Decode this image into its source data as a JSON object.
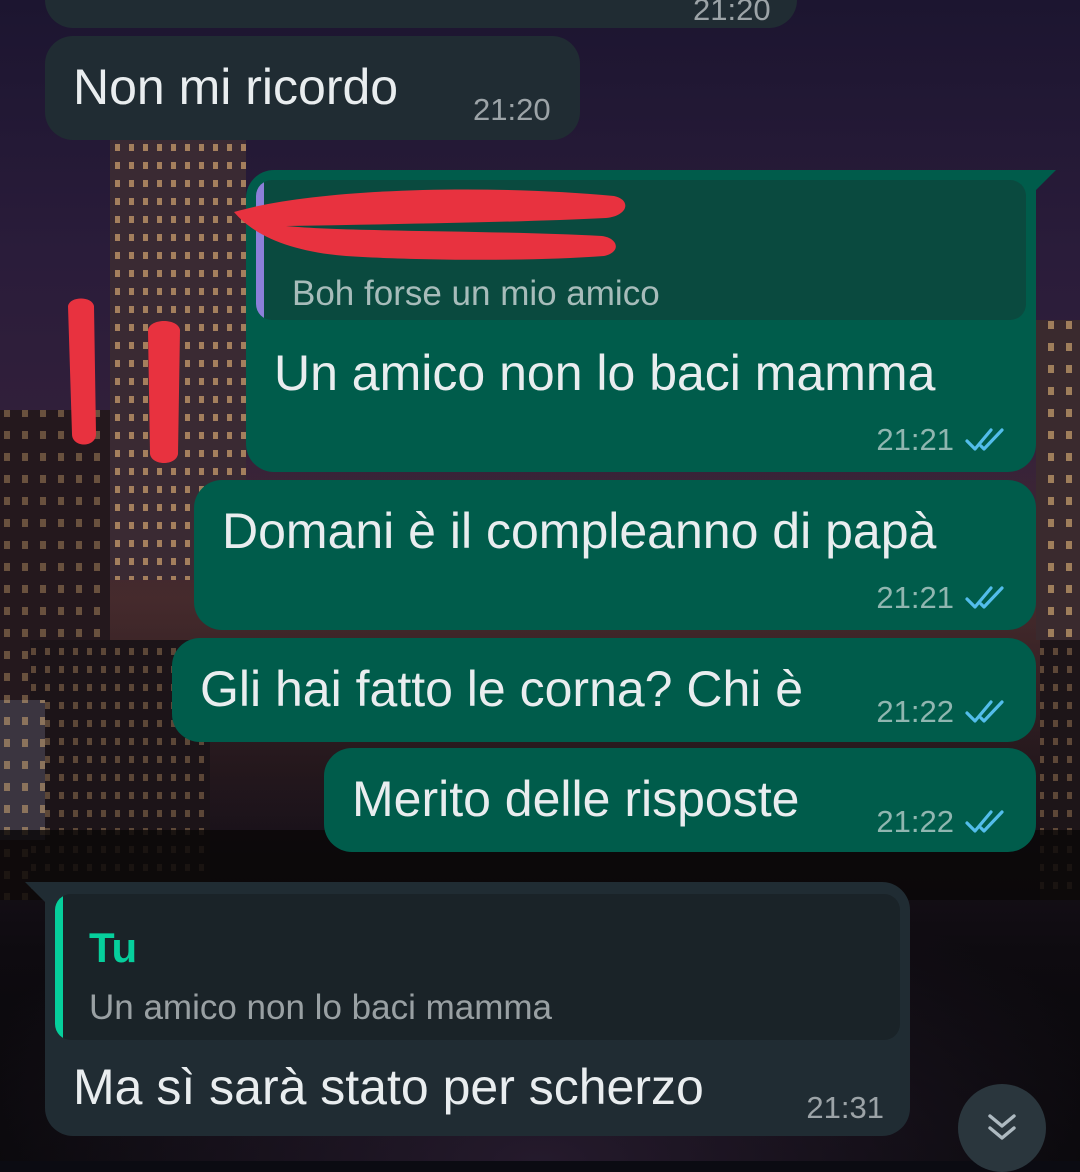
{
  "theme": {
    "incoming_bubble": "#202c33",
    "outgoing_bubble": "#005c4b",
    "text_color": "#e9edef",
    "read_ticks_color": "#53bdeb",
    "reply_accent_self": "#06cf9c",
    "reply_accent_contact": "#8c7fd9",
    "redaction_color": "#e8323f"
  },
  "messages": [
    {
      "id": "top-partial",
      "direction": "incoming",
      "text": "",
      "time": "21:20"
    },
    {
      "id": "m1",
      "direction": "incoming",
      "text": "Non mi ricordo",
      "time": "21:20"
    },
    {
      "id": "m2",
      "direction": "outgoing",
      "reply_to": {
        "author": "",
        "author_redacted": true,
        "text": "Boh forse un mio amico"
      },
      "text": "Un amico non lo baci mamma",
      "time": "21:21",
      "status": "read",
      "status_icon": "double-check-icon"
    },
    {
      "id": "m3",
      "direction": "outgoing",
      "text": "Domani è il compleanno di papà",
      "time": "21:21",
      "status": "read",
      "status_icon": "double-check-icon"
    },
    {
      "id": "m4",
      "direction": "outgoing",
      "text": "Gli hai fatto le corna? Chi è",
      "time": "21:22",
      "status": "read",
      "status_icon": "double-check-icon"
    },
    {
      "id": "m5",
      "direction": "outgoing",
      "text": "Merito delle risposte",
      "time": "21:22",
      "status": "read",
      "status_icon": "double-check-icon"
    },
    {
      "id": "m6",
      "direction": "incoming",
      "reply_to": {
        "author": "Tu",
        "text": "Un amico non lo baci mamma"
      },
      "text": "Ma sì sarà stato per scherzo",
      "time": "21:31"
    }
  ],
  "scroll_button": {
    "icon": "double-chevron-down-icon"
  }
}
